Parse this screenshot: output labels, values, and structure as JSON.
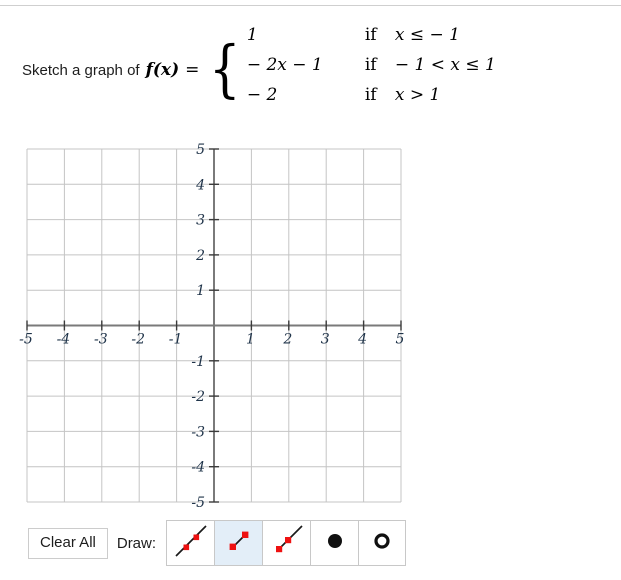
{
  "prompt": {
    "lead_text": "Sketch a graph of",
    "function_name": "f(x)",
    "equals": "=",
    "cases": [
      {
        "expr": "1",
        "if": "if",
        "cond": "x ≤ − 1"
      },
      {
        "expr": "− 2x − 1",
        "if": "if",
        "cond": "− 1 < x ≤ 1"
      },
      {
        "expr": "− 2",
        "if": "if",
        "cond": "x > 1"
      }
    ]
  },
  "graph": {
    "x_labels": [
      "-5",
      "-4",
      "-3",
      "-2",
      "-1",
      "1",
      "2",
      "3",
      "4",
      "5"
    ],
    "y_labels": [
      "5",
      "4",
      "3",
      "2",
      "1",
      "-1",
      "-2",
      "-3",
      "-4",
      "-5"
    ],
    "x_min": -5,
    "x_max": 5,
    "y_min": -5,
    "y_max": 5,
    "grid_step": 1,
    "grid_color": "#c4c4c4",
    "axis_color": "#7a7a7a",
    "label_color": "#20344a",
    "plotted_points": []
  },
  "toolbar": {
    "clear_all_label": "Clear All",
    "draw_label": "Draw:",
    "tools": [
      {
        "name": "line-tool",
        "icon": "infinite-line-icon",
        "selected": false
      },
      {
        "name": "segment-tool",
        "icon": "line-segment-icon",
        "selected": true
      },
      {
        "name": "ray-tool",
        "icon": "ray-icon",
        "selected": false
      },
      {
        "name": "closed-dot-tool",
        "icon": "filled-circle-icon",
        "selected": false
      },
      {
        "name": "open-dot-tool",
        "icon": "hollow-circle-icon",
        "selected": false
      }
    ],
    "point_color": "#ee1111",
    "selected_bg": "#e3eef8"
  }
}
